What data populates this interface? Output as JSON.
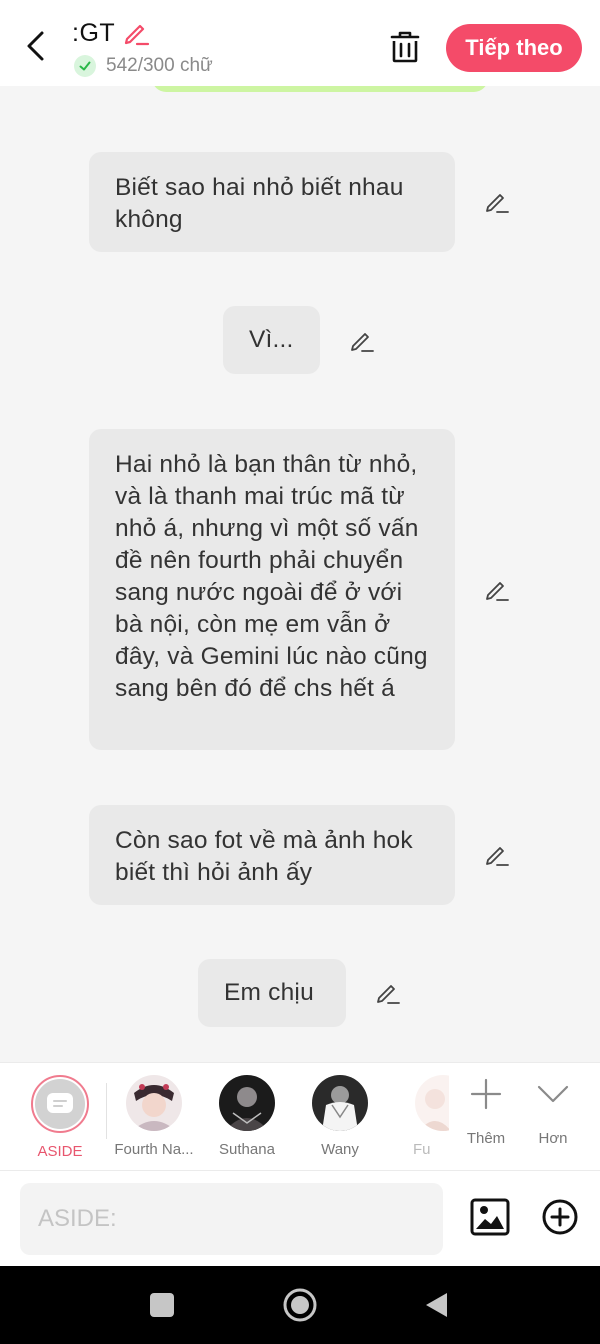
{
  "header": {
    "title": ":GT",
    "word_count": "542/300 chữ",
    "next_label": "Tiếp theo"
  },
  "messages": [
    {
      "text": "Biết sao hai nhỏ biết nhau không"
    },
    {
      "text": "Vì..."
    },
    {
      "text": "Hai nhỏ là bạn thân từ nhỏ, và là thanh mai trúc mã từ nhỏ á, nhưng vì một số vấn đề nên fourth phải chuyển sang nước ngoài để ở với bà nội, còn mẹ em vẫn ở đây, và Gemini lúc nào cũng sang bên đó để chs hết á"
    },
    {
      "text": "Còn sao fot về mà ảnh hok biết thì hỏi ảnh ấy"
    },
    {
      "text": "Em chịu"
    }
  ],
  "characters": [
    {
      "name": "ASIDE"
    },
    {
      "name": "Fourth Na..."
    },
    {
      "name": "Suthana"
    },
    {
      "name": "Wany"
    },
    {
      "name": "Fu"
    }
  ],
  "more": {
    "add_label": "Thêm",
    "expand_label": "Hơn"
  },
  "composer": {
    "placeholder": "ASIDE:"
  },
  "colors": {
    "accent": "#f44b69",
    "bubble": "#e9e9e9",
    "background": "#f5f5f5",
    "aside_active": "#e8566e"
  }
}
